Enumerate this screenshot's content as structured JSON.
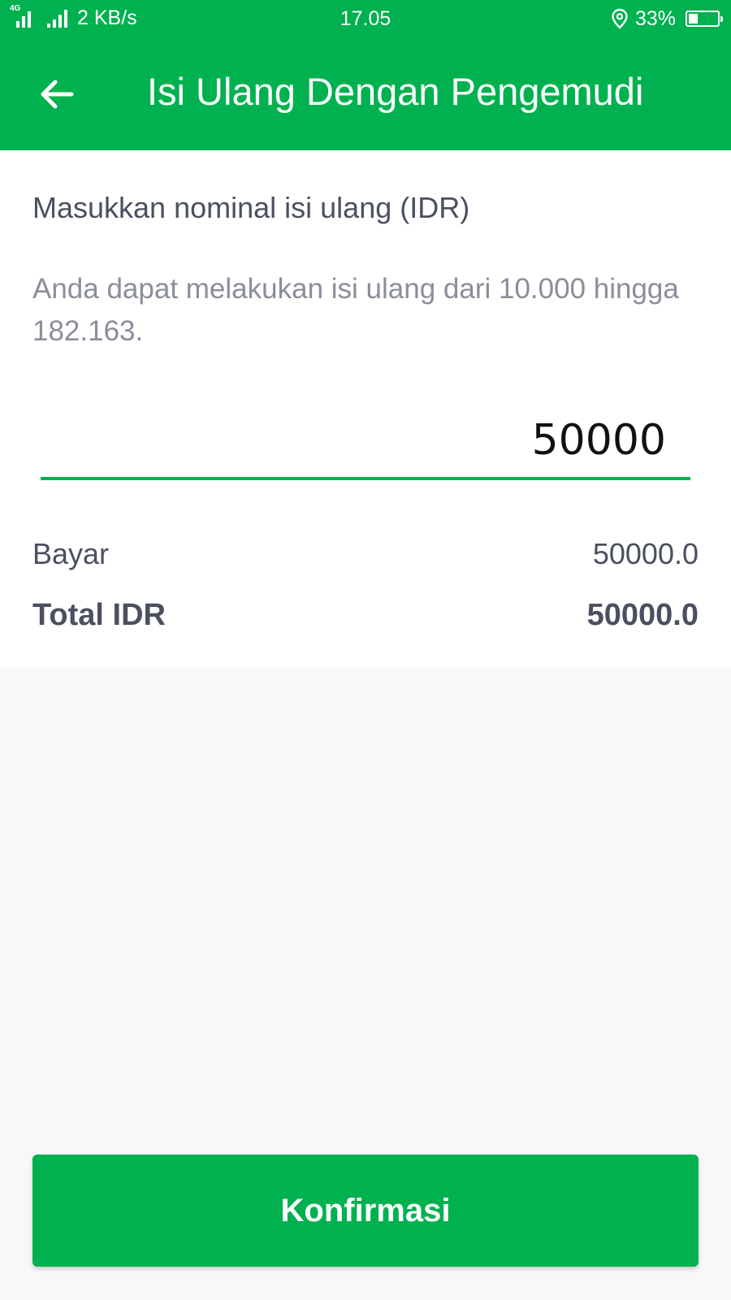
{
  "status_bar": {
    "network_type": "4G",
    "net_speed": "2 KB/s",
    "time": "17.05",
    "battery_percent": "33%",
    "battery_level": 0.33
  },
  "app_bar": {
    "back_icon": "arrow-left-icon",
    "title": "Isi Ulang Dengan Pengemudi"
  },
  "form": {
    "prompt_label": "Masukkan nominal isi ulang (IDR)",
    "range_hint": "Anda dapat melakukan isi ulang dari 10.000 hingga 182.163.",
    "amount_value": "50000"
  },
  "summary": {
    "pay_label": "Bayar",
    "pay_value": "50000.0",
    "total_label": "Total IDR",
    "total_value": "50000.0"
  },
  "confirm_label": "Konfirmasi",
  "colors": {
    "brand_green": "#00b14f",
    "text_dark": "#4a5060",
    "text_muted": "#8a8e9a",
    "background": "#f7f8fa"
  }
}
